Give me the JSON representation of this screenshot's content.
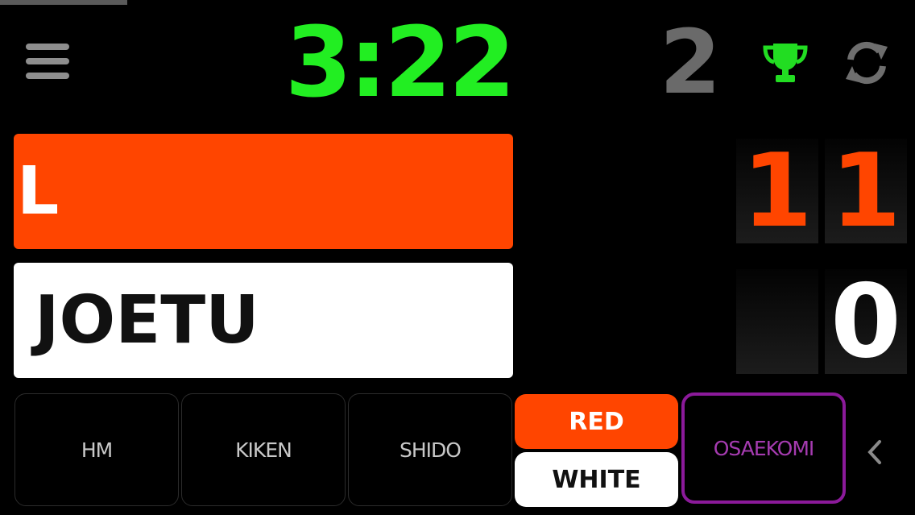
{
  "timer": {
    "clock": "3:22"
  },
  "round": {
    "number": "2"
  },
  "red": {
    "name": "L",
    "score_digits": [
      "1",
      "1"
    ],
    "color": "#ff4500"
  },
  "white": {
    "name": "JOETU",
    "score_digits": [
      "",
      "0"
    ],
    "color": "#ffffff"
  },
  "buttons": {
    "hm": "HM",
    "kiken": "KIKEN",
    "shido": "SHIDO",
    "red": "RED",
    "white": "WHITE",
    "osaekomi": "OSAEKOMI"
  },
  "icons": {
    "menu": "menu-icon",
    "trophy": "trophy-icon",
    "refresh": "refresh-icon",
    "collapse": "chevron-left-icon"
  },
  "colors": {
    "clock": "#22ee22",
    "trophy": "#22dd22",
    "osaekomi_border": "#8b1a9a"
  }
}
